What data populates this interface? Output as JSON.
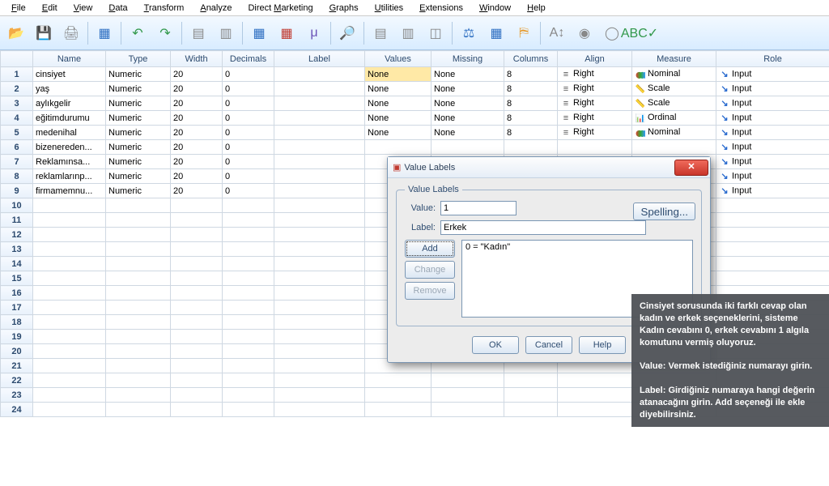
{
  "menu": {
    "items": [
      {
        "label": "File",
        "mn": "F",
        "rest": "ile"
      },
      {
        "label": "Edit",
        "mn": "E",
        "rest": "dit"
      },
      {
        "label": "View",
        "mn": "V",
        "rest": "iew"
      },
      {
        "label": "Data",
        "mn": "D",
        "rest": "ata"
      },
      {
        "label": "Transform",
        "mn": "T",
        "rest": "ransform"
      },
      {
        "label": "Analyze",
        "mn": "A",
        "rest": "nalyze"
      },
      {
        "label": "Direct Marketing",
        "mn": "M",
        "rest": "",
        "pre": "Direct ",
        "post": "arketing"
      },
      {
        "label": "Graphs",
        "mn": "G",
        "rest": "raphs"
      },
      {
        "label": "Utilities",
        "mn": "U",
        "rest": "tilities"
      },
      {
        "label": "Extensions",
        "mn": "E",
        "rest": "xtensions"
      },
      {
        "label": "Window",
        "mn": "W",
        "rest": "indow"
      },
      {
        "label": "Help",
        "mn": "H",
        "rest": "elp"
      }
    ]
  },
  "toolbar": {
    "buttons": [
      {
        "name": "open-file-icon",
        "glyph": "📂",
        "cls": "c-orange"
      },
      {
        "name": "save-icon",
        "glyph": "💾",
        "cls": "c-gray"
      },
      {
        "name": "print-icon",
        "glyph": "🖨",
        "cls": "c-gray"
      },
      {
        "name": "sep"
      },
      {
        "name": "recall-dialog-icon",
        "glyph": "▦",
        "cls": "c-blue"
      },
      {
        "name": "sep"
      },
      {
        "name": "undo-icon",
        "glyph": "↶",
        "cls": "c-green"
      },
      {
        "name": "redo-icon",
        "glyph": "↷",
        "cls": "c-green"
      },
      {
        "name": "sep"
      },
      {
        "name": "go-to-case-icon",
        "glyph": "▤",
        "cls": "c-gray"
      },
      {
        "name": "go-to-variable-icon",
        "glyph": "▥",
        "cls": "c-gray"
      },
      {
        "name": "sep"
      },
      {
        "name": "variables-icon",
        "glyph": "▦",
        "cls": "c-blue"
      },
      {
        "name": "run-descriptives-icon",
        "glyph": "▦",
        "cls": "c-red"
      },
      {
        "name": "compute-icon",
        "glyph": "μ",
        "cls": "c-purple"
      },
      {
        "name": "sep"
      },
      {
        "name": "find-icon",
        "glyph": "🔎",
        "cls": ""
      },
      {
        "name": "sep"
      },
      {
        "name": "insert-cases-icon",
        "glyph": "▤",
        "cls": "c-gray"
      },
      {
        "name": "insert-variable-icon",
        "glyph": "▥",
        "cls": "c-gray"
      },
      {
        "name": "split-file-icon",
        "glyph": "◫",
        "cls": "c-gray"
      },
      {
        "name": "sep"
      },
      {
        "name": "weight-cases-icon",
        "glyph": "⚖",
        "cls": "c-blue"
      },
      {
        "name": "select-cases-icon",
        "glyph": "▦",
        "cls": "c-blue"
      },
      {
        "name": "value-labels-icon",
        "glyph": "⛿",
        "cls": "c-orange"
      },
      {
        "name": "sep"
      },
      {
        "name": "use-variable-sets-icon",
        "glyph": "A↕",
        "cls": "c-gray"
      },
      {
        "name": "show-all-variables-icon",
        "glyph": "◉",
        "cls": "c-gray"
      },
      {
        "name": "customize-toolbar-icon",
        "glyph": "◯",
        "cls": "c-gray"
      },
      {
        "name": "spellcheck-icon",
        "glyph": "ABC✓",
        "cls": "c-green"
      }
    ]
  },
  "grid": {
    "headers": [
      "",
      "Name",
      "Type",
      "Width",
      "Decimals",
      "Label",
      "Values",
      "Missing",
      "Columns",
      "Align",
      "Measure",
      "Role"
    ],
    "rows": [
      {
        "n": 1,
        "name": "cinsiyet",
        "type": "Numeric",
        "width": "20",
        "dec": "0",
        "label": "",
        "values": "None",
        "missing": "None",
        "columns": "8",
        "align": "Right",
        "measure": "Nominal",
        "measure_cls": "icon-nominal",
        "role": "Input",
        "sel_values": true
      },
      {
        "n": 2,
        "name": "yaş",
        "type": "Numeric",
        "width": "20",
        "dec": "0",
        "label": "",
        "values": "None",
        "missing": "None",
        "columns": "8",
        "align": "Right",
        "measure": "Scale",
        "measure_cls": "icon-scale",
        "role": "Input"
      },
      {
        "n": 3,
        "name": "aylıkgelir",
        "type": "Numeric",
        "width": "20",
        "dec": "0",
        "label": "",
        "values": "None",
        "missing": "None",
        "columns": "8",
        "align": "Right",
        "measure": "Scale",
        "measure_cls": "icon-scale",
        "role": "Input"
      },
      {
        "n": 4,
        "name": "eğitimdurumu",
        "type": "Numeric",
        "width": "20",
        "dec": "0",
        "label": "",
        "values": "None",
        "missing": "None",
        "columns": "8",
        "align": "Right",
        "measure": "Ordinal",
        "measure_cls": "icon-ordinal",
        "role": "Input"
      },
      {
        "n": 5,
        "name": "medenihal",
        "type": "Numeric",
        "width": "20",
        "dec": "0",
        "label": "",
        "values": "None",
        "missing": "None",
        "columns": "8",
        "align": "Right",
        "measure": "Nominal",
        "measure_cls": "icon-nominal",
        "role": "Input"
      },
      {
        "n": 6,
        "name": "bizenereden...",
        "type": "Numeric",
        "width": "20",
        "dec": "0",
        "label": "",
        "values": "",
        "missing": "",
        "columns": "",
        "align": "",
        "measure": "",
        "measure_cls": "",
        "role": "Input"
      },
      {
        "n": 7,
        "name": "Reklamınsa...",
        "type": "Numeric",
        "width": "20",
        "dec": "0",
        "label": "",
        "values": "",
        "missing": "",
        "columns": "",
        "align": "",
        "measure": "",
        "measure_cls": "",
        "role": "Input"
      },
      {
        "n": 8,
        "name": "reklamlarınp...",
        "type": "Numeric",
        "width": "20",
        "dec": "0",
        "label": "",
        "values": "",
        "missing": "",
        "columns": "",
        "align": "",
        "measure": "",
        "measure_cls": "",
        "role": "Input"
      },
      {
        "n": 9,
        "name": "firmamemnu...",
        "type": "Numeric",
        "width": "20",
        "dec": "0",
        "label": "",
        "values": "",
        "missing": "",
        "columns": "",
        "align": "",
        "measure": "",
        "measure_cls": "",
        "role": "Input"
      }
    ],
    "empty_rows": [
      10,
      11,
      12,
      13,
      14,
      15,
      16,
      17,
      18,
      19,
      20,
      21,
      22,
      23,
      24
    ]
  },
  "dialog": {
    "title": "Value Labels",
    "legend": "Value Labels",
    "value_label": "Value:",
    "label_label": "Label:",
    "value_input": "1",
    "label_input": "Erkek",
    "list_entry": "0 = \"Kadın\"",
    "add": "Add",
    "change": "Change",
    "remove": "Remove",
    "spelling": "Spelling...",
    "ok": "OK",
    "cancel": "Cancel",
    "help": "Help"
  },
  "info": {
    "p1": "Cinsiyet sorusunda iki farklı cevap olan kadın ve erkek seçeneklerini, sisteme Kadın cevabını 0, erkek cevabını 1 algıla komutunu vermiş oluyoruz.",
    "p2": "Value: Vermek istediğiniz numarayı girin.",
    "p3": "Label: Girdiğiniz numaraya hangi değerin atanacağını girin. Add seçeneği ile ekle diyebilirsiniz."
  }
}
